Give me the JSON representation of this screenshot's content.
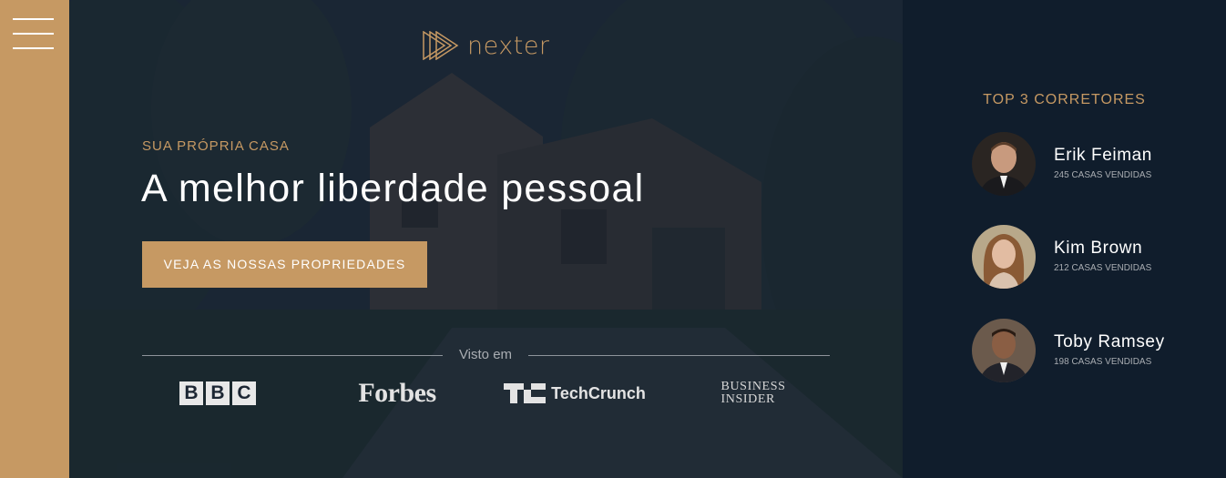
{
  "sidebar": {
    "menu_icon": "hamburger-menu-icon",
    "accent": "#c69963"
  },
  "header": {
    "logo_text": "nexter",
    "logo_icon": "play-triangles-logo"
  },
  "hero": {
    "subtitle": "SUA PRÓPRIA CASA",
    "title": "A melhor liberdade pessoal",
    "cta_label": "VEJA AS NOSSAS PROPRIEDADES",
    "seen_on_label": "Visto em",
    "press": [
      {
        "name": "BBC",
        "letters": [
          "B",
          "B",
          "C"
        ]
      },
      {
        "name": "Forbes"
      },
      {
        "name": "TechCrunch",
        "mark": "TC"
      },
      {
        "name": "Business Insider",
        "line1": "BUSINESS",
        "line2": "INSIDER"
      }
    ]
  },
  "realtors": {
    "title": "TOP 3 CORRETORES",
    "items": [
      {
        "name": "Erik Feiman",
        "sold": "245 CASAS VENDIDAS"
      },
      {
        "name": "Kim Brown",
        "sold": "212 CASAS VENDIDAS"
      },
      {
        "name": "Toby Ramsey",
        "sold": "198 CASAS VENDIDAS"
      }
    ]
  },
  "colors": {
    "primary": "#c69963",
    "dark": "#101d2c",
    "text_light": "#ffffff",
    "text_muted": "#a9adb2"
  }
}
